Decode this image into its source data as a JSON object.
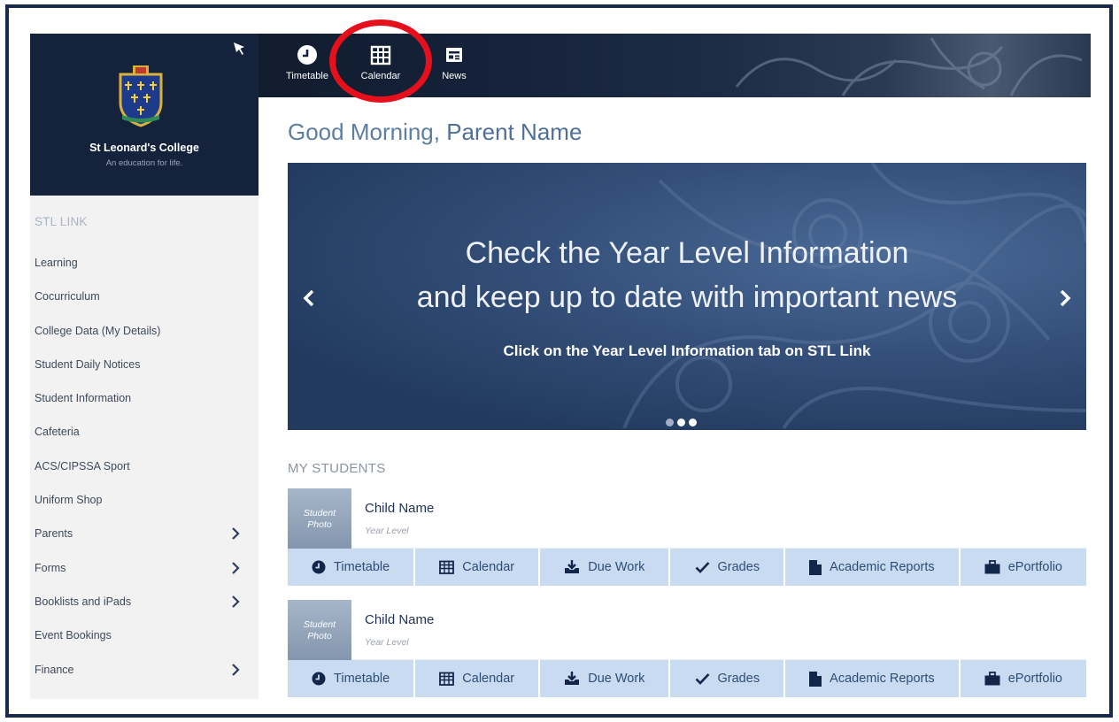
{
  "brand": {
    "name": "St Leonard's College",
    "tagline": "An education for life."
  },
  "sidebar": {
    "heading": "STL LINK",
    "items": [
      {
        "label": "Learning",
        "has_submenu": false
      },
      {
        "label": "Cocurriculum",
        "has_submenu": false
      },
      {
        "label": "College Data (My Details)",
        "has_submenu": false
      },
      {
        "label": "Student Daily Notices",
        "has_submenu": false
      },
      {
        "label": "Student Information",
        "has_submenu": false
      },
      {
        "label": "Cafeteria",
        "has_submenu": false
      },
      {
        "label": "ACS/CIPSSA Sport",
        "has_submenu": false
      },
      {
        "label": "Uniform Shop",
        "has_submenu": false
      },
      {
        "label": "Parents",
        "has_submenu": true
      },
      {
        "label": "Forms",
        "has_submenu": true
      },
      {
        "label": "Booklists and iPads",
        "has_submenu": true
      },
      {
        "label": "Event Bookings",
        "has_submenu": false
      },
      {
        "label": "Finance",
        "has_submenu": true
      }
    ]
  },
  "topbar": {
    "items": [
      {
        "label": "Timetable",
        "icon": "clock-icon"
      },
      {
        "label": "Calendar",
        "icon": "calendar-icon",
        "highlighted": true
      },
      {
        "label": "News",
        "icon": "newspaper-icon"
      }
    ],
    "highlight_color": "#e6101c"
  },
  "greeting": {
    "salutation": "Good Morning,",
    "name": "Parent Name"
  },
  "banner": {
    "line1": "Check the Year Level Information",
    "line2": "and keep up to date with important news",
    "subtitle": "Click on the Year Level Information tab on STL Link",
    "slide_count": 3,
    "active_slide": 2
  },
  "my_students": {
    "title": "MY STUDENTS",
    "students": [
      {
        "photo_label_line1": "Student",
        "photo_label_line2": "Photo",
        "name": "Child Name",
        "year_level": "Year Level",
        "actions": [
          {
            "label": "Timetable",
            "icon": "clock-icon"
          },
          {
            "label": "Calendar",
            "icon": "calendar-icon"
          },
          {
            "label": "Due Work",
            "icon": "download-tray-icon"
          },
          {
            "label": "Grades",
            "icon": "checkmark-icon"
          },
          {
            "label": "Academic Reports",
            "icon": "document-icon"
          },
          {
            "label": "ePortfolio",
            "icon": "briefcase-icon"
          }
        ]
      },
      {
        "photo_label_line1": "Student",
        "photo_label_line2": "Photo",
        "name": "Child Name",
        "year_level": "Year Level",
        "actions": [
          {
            "label": "Timetable",
            "icon": "clock-icon"
          },
          {
            "label": "Calendar",
            "icon": "calendar-icon"
          },
          {
            "label": "Due Work",
            "icon": "download-tray-icon"
          },
          {
            "label": "Grades",
            "icon": "checkmark-icon"
          },
          {
            "label": "Academic Reports",
            "icon": "document-icon"
          },
          {
            "label": "ePortfolio",
            "icon": "briefcase-icon"
          }
        ]
      }
    ]
  },
  "colors": {
    "navy": "#15223b",
    "accent": "#5d7ea3",
    "action_bar": "#c9dbf0",
    "action_text": "#2e4d75"
  }
}
